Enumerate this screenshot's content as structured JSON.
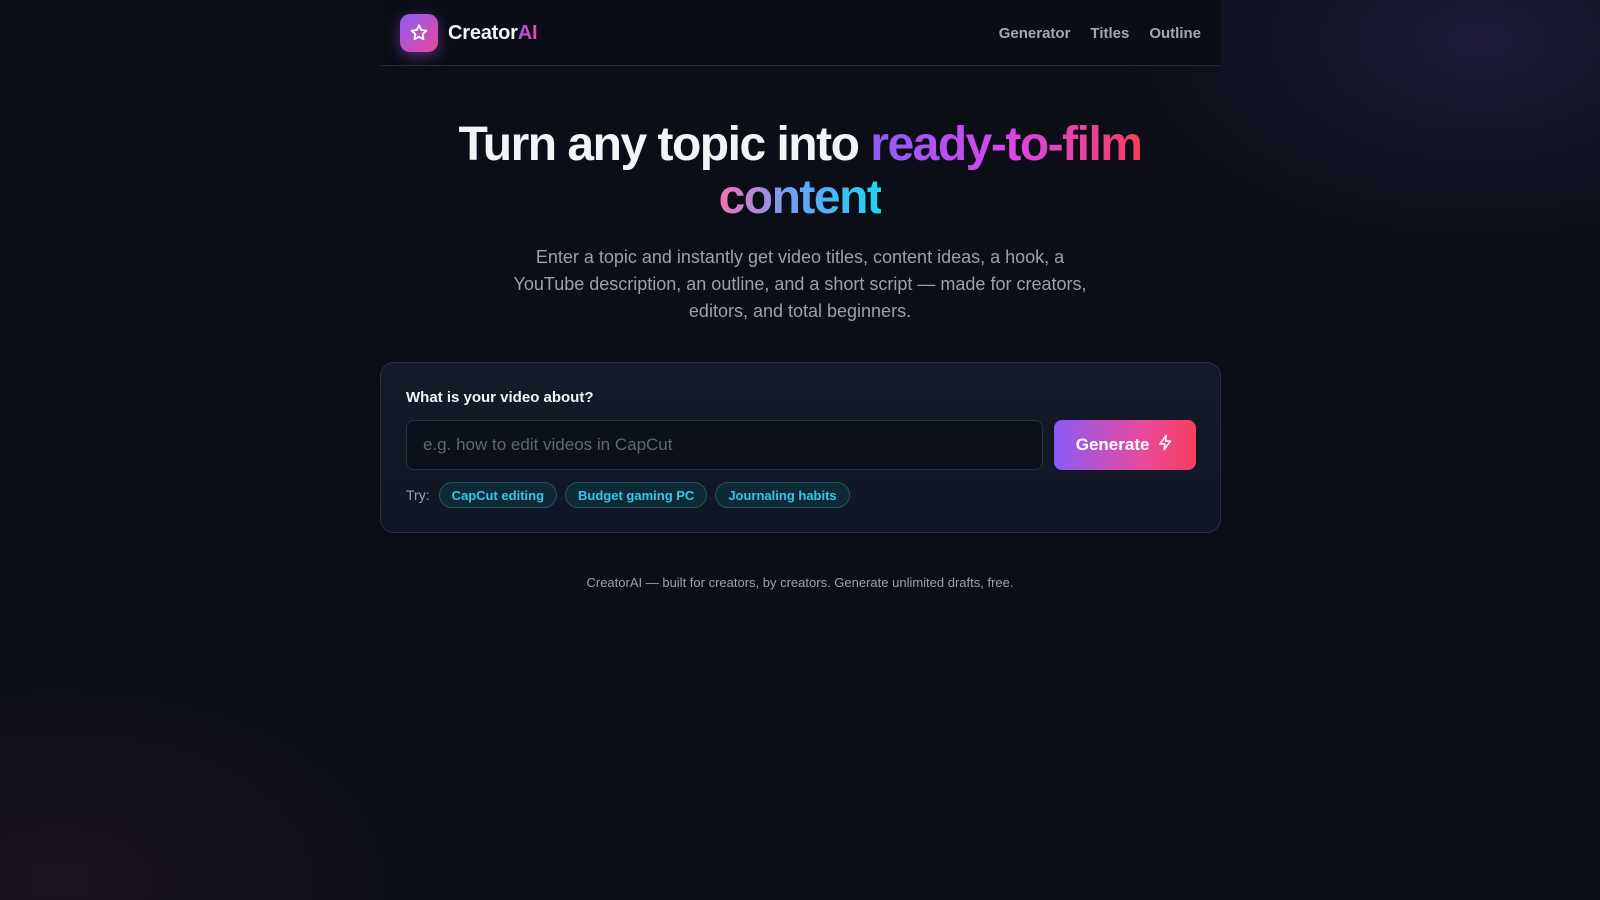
{
  "nav": {
    "brand_prefix": "Creator",
    "brand_suffix": "AI",
    "logo_icon": "star-icon",
    "links": [
      {
        "label": "Generator"
      },
      {
        "label": "Titles"
      },
      {
        "label": "Outline"
      }
    ]
  },
  "hero": {
    "title_plain": "Turn any topic into",
    "title_gradient_1": "ready-to-film",
    "title_gradient_2": "content",
    "subtitle": "Enter a topic and instantly get video titles, content ideas, a hook, a YouTube description, an outline, and a short script — made for creators, editors, and total beginners."
  },
  "form": {
    "label": "What is your video about?",
    "input_value": "",
    "input_placeholder": "e.g. how to edit videos in CapCut",
    "generate_label": "Generate",
    "generate_icon": "lightning-icon",
    "try_label": "Try:",
    "suggestions": [
      "CapCut editing",
      "Budget gaming PC",
      "Journaling habits"
    ]
  },
  "footer": {
    "text": "CreatorAI — built for creators, by creators. Generate unlimited drafts, free."
  },
  "colors": {
    "background": "#0b0e17",
    "accent_purple": "#8b5cf6",
    "accent_pink": "#ec4899",
    "accent_cyan": "#22d3ee"
  }
}
